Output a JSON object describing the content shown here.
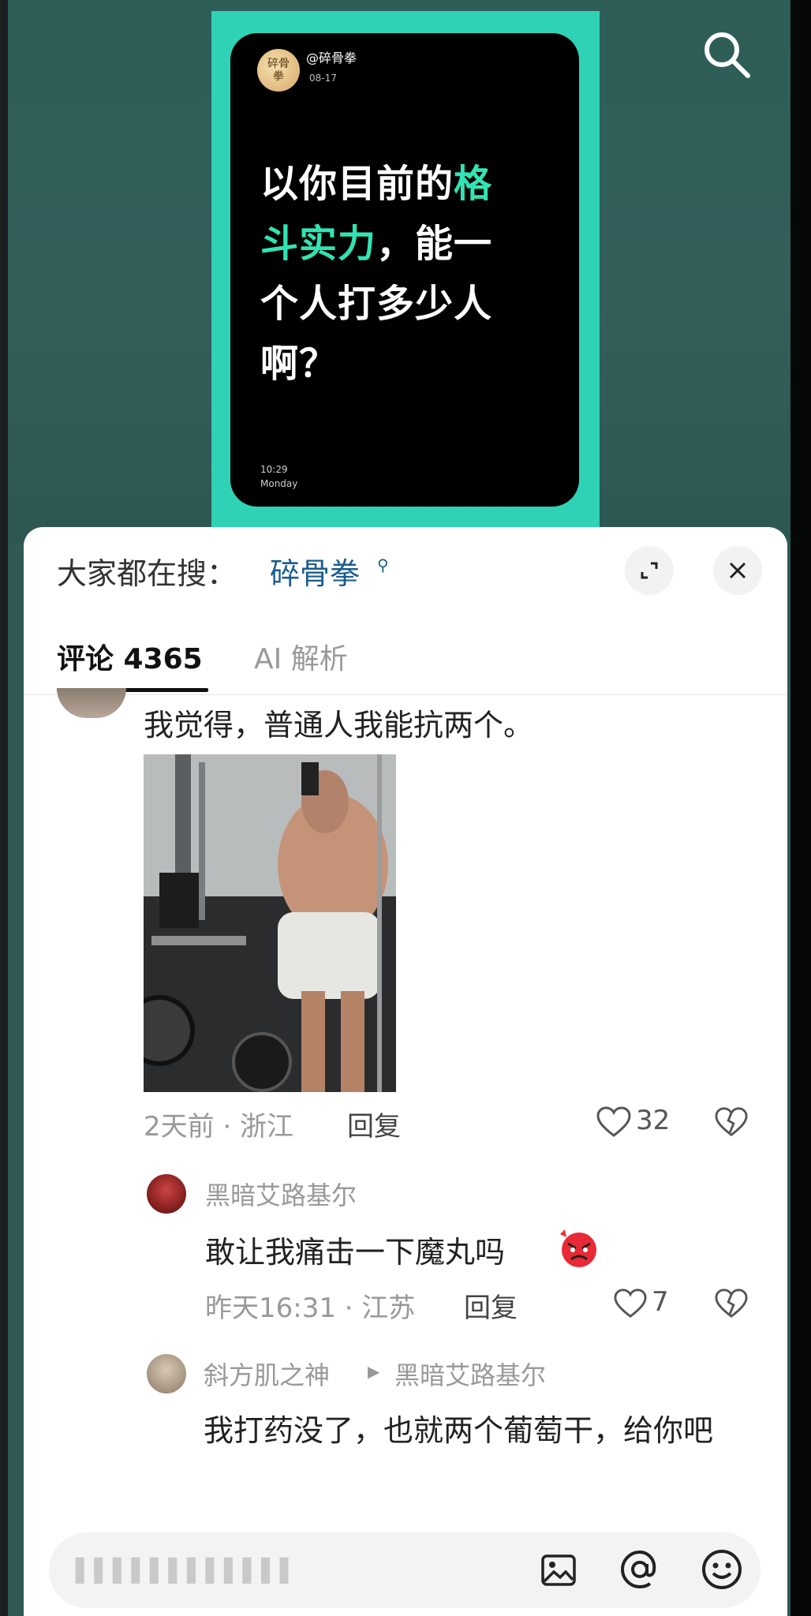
{
  "poster": {
    "avatar_text": "碎骨拳",
    "handle": "@碎骨拳",
    "date": "08-17",
    "line1_a": "以你目前的",
    "line1_b": "格",
    "line2_a": "斗实力",
    "line2_b": "，能一",
    "line3": "个人打多少人",
    "line4": "啊？",
    "time": "10:29",
    "day": "Monday"
  },
  "search": {
    "prefix": "大家都在搜：",
    "term": "碎骨拳",
    "term_icon": "search-icon"
  },
  "tabs": {
    "comments_label": "评论 4365",
    "ai_label": "AI 解析"
  },
  "comment": {
    "text": "我觉得，普通人我能抗两个。",
    "meta": "2天前 · 浙江",
    "reply_label": "回复",
    "likes": "32"
  },
  "reply1": {
    "name": "黑暗艾路基尔",
    "text": "敢让我痛击一下魔丸吗",
    "emoji": "angry-face-emoji",
    "meta": "昨天16:31 · 江苏",
    "reply_label": "回复",
    "likes": "7"
  },
  "reply2": {
    "name": "斜方肌之神",
    "arrow": "▶",
    "target": "黑暗艾路基尔",
    "text": "我打药没了，也就两个葡萄干，给你吧"
  },
  "input": {
    "placeholder": "▌▌▌▌▌▌▌▌▌▌▌▌"
  },
  "colors": {
    "poster_frame": "#2fd2b4",
    "highlight": "#33e3b3",
    "search_term": "#1b5d8e"
  }
}
